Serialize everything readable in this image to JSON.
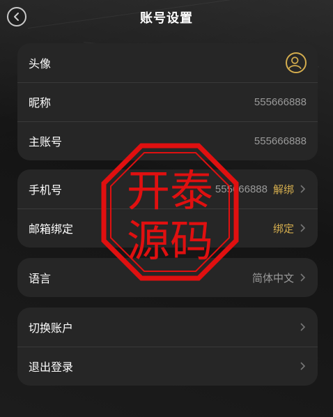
{
  "header": {
    "title": "账号设置"
  },
  "group1": {
    "avatar_label": "头像",
    "nickname_label": "昵称",
    "nickname_value": "555666888",
    "main_account_label": "主账号",
    "main_account_value": "555666888"
  },
  "group2": {
    "phone_label": "手机号",
    "phone_value": "555666888",
    "phone_action": "解绑",
    "email_label": "邮箱绑定",
    "email_action": "绑定"
  },
  "group3": {
    "language_label": "语言",
    "language_value": "简体中文"
  },
  "group4": {
    "switch_label": "切换账户",
    "logout_label": "退出登录"
  },
  "watermark": {
    "line1": "开泰",
    "line2": "源码"
  },
  "colors": {
    "accent": "#d4ad4e",
    "card": "#262626",
    "stamp": "#e01010"
  },
  "icons": [
    "back-icon",
    "avatar-icon",
    "chevron-right-icon"
  ]
}
